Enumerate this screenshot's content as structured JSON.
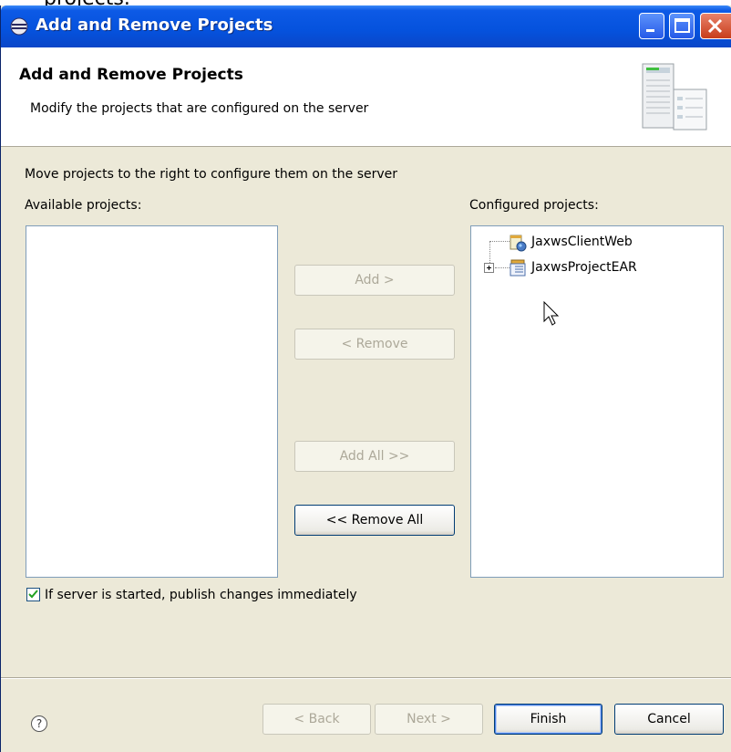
{
  "page_fragment": "projects.",
  "window": {
    "title": "Add and Remove Projects",
    "controls": [
      "minimize-icon",
      "maximize-icon",
      "close-icon"
    ]
  },
  "header": {
    "title": "Add and Remove Projects",
    "description": "Modify the projects that are configured on the server"
  },
  "body": {
    "instruction": "Move projects to the right to configure them on the server",
    "available_label": "Available projects:",
    "configured_label": "Configured projects:",
    "configured_items": [
      {
        "label": "JaxwsClientWeb",
        "icon": "web-project-icon",
        "expandable": false
      },
      {
        "label": "JaxwsProjectEAR",
        "icon": "ear-project-icon",
        "expandable": true
      }
    ],
    "buttons": {
      "add": "Add >",
      "remove": "< Remove",
      "add_all": "Add All >>",
      "remove_all": "<< Remove All"
    },
    "publish_checkbox": {
      "label": "If server is started, publish changes immediately",
      "checked": true
    }
  },
  "footer": {
    "help": "?",
    "back": "< Back",
    "next": "Next >",
    "finish": "Finish",
    "cancel": "Cancel"
  }
}
